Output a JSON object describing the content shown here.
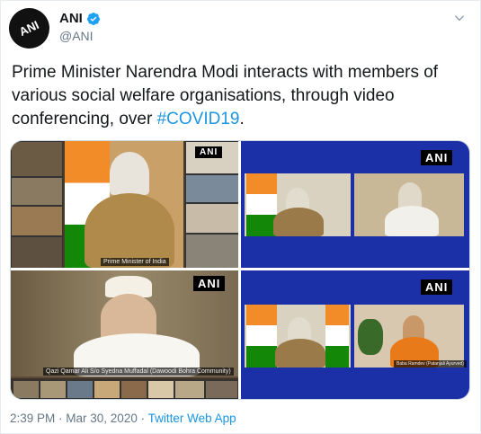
{
  "account": {
    "name": "ANI",
    "handle": "@ANI",
    "avatar_text": "ANI"
  },
  "tweet": {
    "text_before": "Prime Minister Narendra Modi interacts with members of various social welfare organisations, through video conferencing, over ",
    "hashtag": "#COVID19",
    "text_after": "."
  },
  "media": {
    "watermark": "ANI",
    "captions": {
      "panel1": "Prime Minister of India",
      "panel3": "Qazi Qamar Ali S/o Syedna Muffadal (Dawoodi Bohra Community)",
      "panel4": "Baba Ramdev (Patanjali Ayurved)"
    }
  },
  "footer": {
    "time": "2:39 PM",
    "separator1": " · ",
    "date": "Mar 30, 2020",
    "separator2": " · ",
    "app": "Twitter Web App"
  },
  "colors": {
    "link": "#1b95e0",
    "text": "#14171a",
    "muted": "#657786",
    "panel_blue": "#1b2fa6"
  },
  "icons": [
    "verified-badge-icon",
    "chevron-down-icon"
  ]
}
